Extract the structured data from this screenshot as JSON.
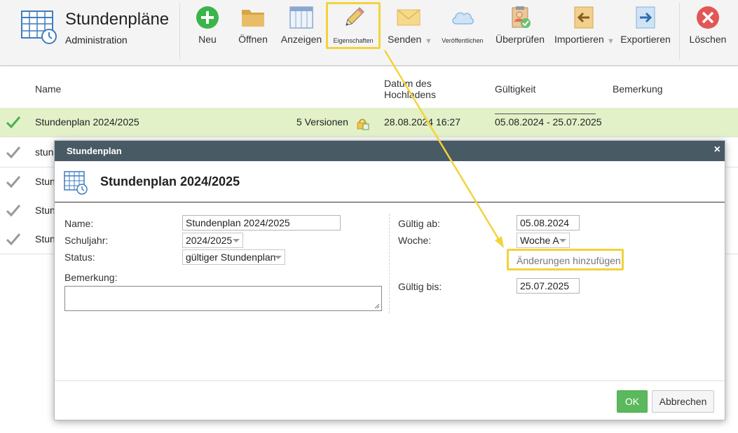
{
  "app": {
    "title": "Stundenpläne",
    "subtitle": "Administration",
    "accent_color": "#3f7cbf"
  },
  "toolbar": {
    "items": [
      {
        "label": "Neu",
        "icon": "plus-circle-icon"
      },
      {
        "label": "Öffnen",
        "icon": "folder-icon"
      },
      {
        "label": "Anzeigen",
        "icon": "table-view-icon"
      },
      {
        "label": "Eigenschaften",
        "icon": "pencil-icon"
      },
      {
        "label": "Senden",
        "icon": "envelope-icon"
      },
      {
        "label": "Veröffentlichen",
        "icon": "cloud-icon"
      },
      {
        "label": "Überprüfen",
        "icon": "clipboard-check-icon"
      },
      {
        "label": "Importieren",
        "icon": "import-arrow-icon"
      },
      {
        "label": "Exportieren",
        "icon": "export-arrow-icon"
      },
      {
        "label": "Löschen",
        "icon": "delete-circle-icon"
      }
    ],
    "highlight_color": "#f2d33b"
  },
  "table": {
    "columns": [
      "Name",
      "Datum des Hochladens",
      "Gültigkeit",
      "Bemerkung"
    ],
    "rows": [
      {
        "name": "Stundenplan 2024/2025",
        "versions": "5 Versionen",
        "uploaded": "28.08.2024 16:27",
        "validity": "05.08.2024 - 25.07.2025",
        "selected": true
      },
      {
        "name": "stund",
        "selected": false
      },
      {
        "name": "Stun",
        "selected": false
      },
      {
        "name": "Stun",
        "selected": false
      },
      {
        "name": "Stun",
        "selected": false
      }
    ]
  },
  "dialog": {
    "titlebar": "Stundenplan",
    "close_symbol": "×",
    "heading": "Stundenplan 2024/2025",
    "fields": {
      "name_label": "Name:",
      "name_value": "Stundenplan 2024/2025",
      "schuljahr_label": "Schuljahr:",
      "schuljahr_value": "2024/2025",
      "status_label": "Status:",
      "status_value": "gültiger Stundenplan",
      "bemerkung_label": "Bemerkung:",
      "gueltig_ab_label": "Gültig ab:",
      "gueltig_ab_value": "05.08.2024",
      "woche_label": "Woche:",
      "woche_value": "Woche A",
      "aenderungen_label": "Änderungen hinzufügen",
      "gueltig_bis_label": "Gültig bis:",
      "gueltig_bis_value": "25.07.2025"
    },
    "ok_label": "OK",
    "cancel_label": "Abbrechen",
    "titlebar_color": "#485a64",
    "ok_color": "#5cb85c"
  }
}
